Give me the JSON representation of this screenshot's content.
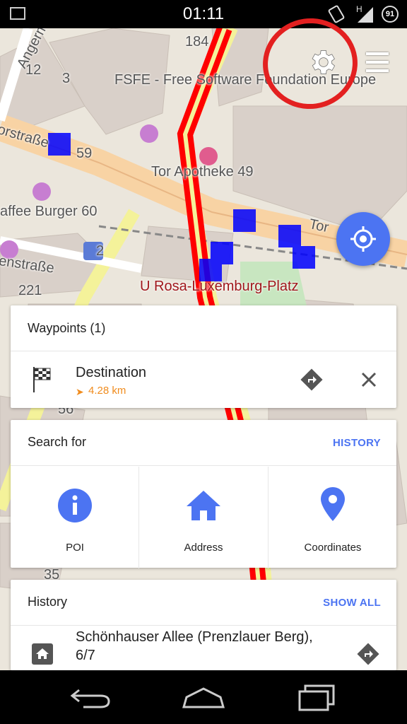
{
  "status_bar": {
    "time": "01:11",
    "network": "H",
    "battery": "91",
    "icons": [
      "image-icon",
      "screen-rotation-icon",
      "signal-icon",
      "battery-icon"
    ]
  },
  "map": {
    "labels": {
      "number_184": "184",
      "number_12": "12",
      "number_3": "3",
      "fsfe": "FSFE - Free Software Foundation Europe",
      "anger": "Angermünd",
      "torstrasse_left": "orstraße",
      "number_59": "59",
      "apotheke": "Tor Apotheke 49",
      "kaffee": "affee Burger 60",
      "number_2": "2",
      "enstrasse": "enstraße",
      "number_221": "221",
      "rosa": "U Rosa-Luxemburg-Platz",
      "tor_right": "Tor",
      "number_56": "56",
      "number_35": "35"
    },
    "colors": {
      "route": "#ff0000",
      "primary_road": "#f8d3a4",
      "secondary_road": "#f4f29a",
      "building": "#d9d0c9",
      "park": "#c8e6c0",
      "transit_marker": "#0000ff"
    }
  },
  "controls": {
    "settings_icon": "gear-icon",
    "menu_icon": "hamburger-menu-icon",
    "locate_icon": "my-location-icon",
    "annotation_color": "#e32020"
  },
  "waypoints": {
    "title": "Waypoints (1)",
    "items": [
      {
        "name": "Destination",
        "distance": "4.28 km",
        "icon": "checkered-flag-icon"
      }
    ]
  },
  "search": {
    "title": "Search for",
    "history_link": "HISTORY",
    "options": [
      {
        "label": "POI",
        "icon": "info-icon"
      },
      {
        "label": "Address",
        "icon": "home-icon"
      },
      {
        "label": "Coordinates",
        "icon": "map-pin-icon"
      }
    ]
  },
  "history": {
    "title": "History",
    "show_all": "SHOW ALL",
    "items": [
      {
        "name": "Schönhauser Allee (Prenzlauer Berg), 6/7",
        "icon": "home-icon"
      }
    ]
  },
  "accent_color": "#4c74f2"
}
